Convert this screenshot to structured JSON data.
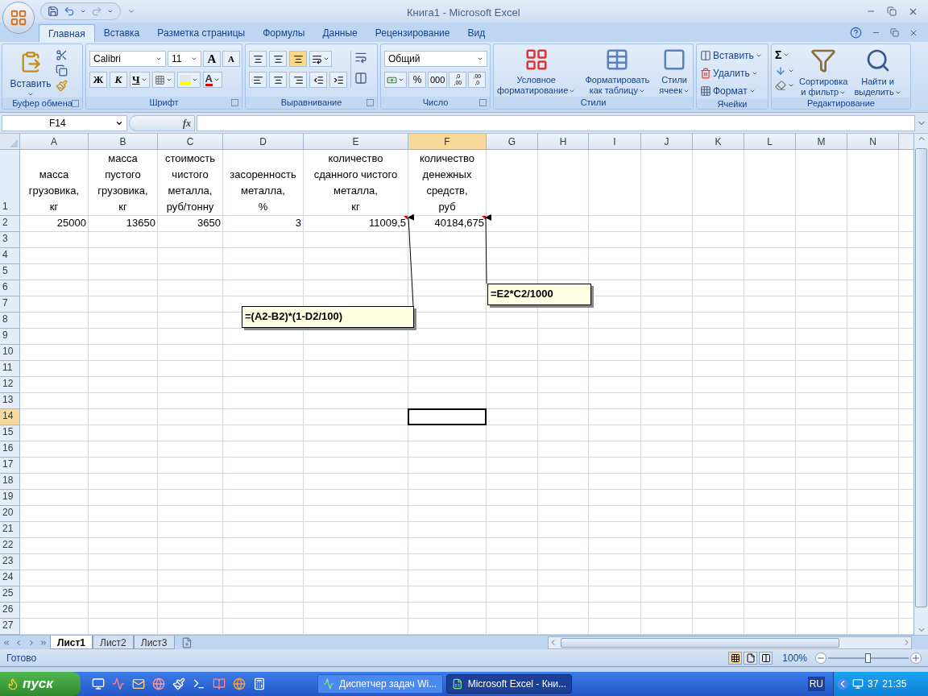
{
  "window": {
    "title": "Книга1 - Microsoft Excel"
  },
  "ribbon_tabs": [
    {
      "label": "Главная",
      "selected": true
    },
    {
      "label": "Вставка",
      "selected": false
    },
    {
      "label": "Разметка страницы",
      "selected": false
    },
    {
      "label": "Формулы",
      "selected": false
    },
    {
      "label": "Данные",
      "selected": false
    },
    {
      "label": "Рецензирование",
      "selected": false
    },
    {
      "label": "Вид",
      "selected": false
    }
  ],
  "clipboard": {
    "label": "Буфер обмена",
    "paste": "Вставить"
  },
  "font": {
    "label": "Шрифт",
    "name": "Calibri",
    "size": "11",
    "grow": "A",
    "shrink": "A",
    "bold": "Ж",
    "italic": "К",
    "underline": "Ч",
    "color_letter": "A"
  },
  "alignment": {
    "label": "Выравнивание",
    "vertical": [
      {
        "selected": false
      },
      {
        "selected": false
      },
      {
        "selected": true
      }
    ],
    "horizontal": [
      {
        "selected": false
      },
      {
        "selected": false
      },
      {
        "selected": false
      }
    ]
  },
  "number": {
    "label": "Число",
    "format": "Общий",
    "percent": "%",
    "thousands": "000",
    "increase_decimal": [
      ",0",
      ",00"
    ],
    "decrease_decimal": [
      ",00",
      ",0"
    ]
  },
  "styles": {
    "label": "Стили",
    "buttons": [
      {
        "kind": "conditional",
        "lines": [
          "Условное",
          "форматирование"
        ]
      },
      {
        "kind": "table",
        "lines": [
          "Форматировать",
          "как таблицу"
        ]
      },
      {
        "kind": "cell",
        "lines": [
          "Стили",
          "ячеек"
        ]
      }
    ]
  },
  "cells": {
    "label": "Ячейки",
    "buttons": [
      {
        "kind": "insert",
        "label": "Вставить"
      },
      {
        "kind": "delete",
        "label": "Удалить"
      },
      {
        "kind": "format",
        "label": "Формат"
      }
    ]
  },
  "editing": {
    "label": "Редактирование",
    "sum": "Σ",
    "buttons": [
      {
        "kind": "sort",
        "lines": [
          "Сортировка",
          "и фильтр"
        ]
      },
      {
        "kind": "find",
        "lines": [
          "Найти и",
          "выделить"
        ]
      }
    ]
  },
  "formula_bar": {
    "name_box": "F14",
    "fx": "fx"
  },
  "columns": [
    {
      "label": "A",
      "selected": false
    },
    {
      "label": "B",
      "selected": false
    },
    {
      "label": "C",
      "selected": false
    },
    {
      "label": "D",
      "selected": false
    },
    {
      "label": "E",
      "selected": false
    },
    {
      "label": "F",
      "selected": true
    },
    {
      "label": "G",
      "selected": false
    },
    {
      "label": "H",
      "selected": false
    },
    {
      "label": "I",
      "selected": false
    },
    {
      "label": "J",
      "selected": false
    },
    {
      "label": "K",
      "selected": false
    },
    {
      "label": "L",
      "selected": false
    },
    {
      "label": "M",
      "selected": false
    },
    {
      "label": "N",
      "selected": false
    }
  ],
  "rows": [
    {
      "label": "1",
      "selected": false,
      "kind": "header",
      "cells": [
        {
          "text": "масса\nгрузовика,\nкг",
          "comment": false
        },
        {
          "text": "масса\nпустого\nгрузовика,\nкг",
          "comment": false
        },
        {
          "text": "стоимость\nчистого\nметалла,\nруб/тонну",
          "comment": false
        },
        {
          "text": "засоренность\nметалла,\n%",
          "comment": false
        },
        {
          "text": "количество\nсданного чистого\nметалла,\nкг",
          "comment": false
        },
        {
          "text": "количество\nденежных\nсредств,\nруб",
          "comment": false
        }
      ]
    },
    {
      "label": "2",
      "selected": false,
      "kind": "values",
      "cells": [
        {
          "text": "25000",
          "comment": false
        },
        {
          "text": "13650",
          "comment": false
        },
        {
          "text": "3650",
          "comment": false
        },
        {
          "text": "3",
          "comment": false
        },
        {
          "text": "11009,5",
          "comment": true
        },
        {
          "text": "40184,675",
          "comment": true
        }
      ]
    },
    {
      "label": "3",
      "selected": false
    },
    {
      "label": "4",
      "selected": false
    },
    {
      "label": "5",
      "selected": false
    },
    {
      "label": "6",
      "selected": false
    },
    {
      "label": "7",
      "selected": false
    },
    {
      "label": "8",
      "selected": false
    },
    {
      "label": "9",
      "selected": false
    },
    {
      "label": "10",
      "selected": false
    },
    {
      "label": "11",
      "selected": false
    },
    {
      "label": "12",
      "selected": false
    },
    {
      "label": "13",
      "selected": false
    },
    {
      "label": "14",
      "selected": true
    },
    {
      "label": "15",
      "selected": false
    },
    {
      "label": "16",
      "selected": false
    },
    {
      "label": "17",
      "selected": false
    },
    {
      "label": "18",
      "selected": false
    },
    {
      "label": "19",
      "selected": false
    },
    {
      "label": "20",
      "selected": false
    },
    {
      "label": "21",
      "selected": false
    },
    {
      "label": "22",
      "selected": false
    },
    {
      "label": "23",
      "selected": false
    },
    {
      "label": "24",
      "selected": false
    },
    {
      "label": "25",
      "selected": false
    },
    {
      "label": "26",
      "selected": false
    },
    {
      "label": "27",
      "selected": false
    }
  ],
  "comments": [
    {
      "text": "=(A2-B2)*(1-D2/100)"
    },
    {
      "text": "=E2*C2/1000"
    }
  ],
  "sheet_tabs": [
    {
      "label": "Лист1",
      "selected": true
    },
    {
      "label": "Лист2",
      "selected": false
    },
    {
      "label": "Лист3",
      "selected": false
    }
  ],
  "status_bar": {
    "status": "Готово",
    "views": [
      {
        "kind": "normal",
        "selected": true
      },
      {
        "kind": "layout",
        "selected": false
      },
      {
        "kind": "pagebreak",
        "selected": false
      }
    ],
    "zoom": "100%",
    "zoom_slider": {
      "level": 0.5
    }
  },
  "taskbar": {
    "start": "пуск",
    "tasks": [
      {
        "label": "Диспетчер задач Wi...",
        "selected": false
      },
      {
        "label": "Microsoft Excel - Кни...",
        "selected": true
      }
    ],
    "language": "RU",
    "tray_number": "37",
    "clock": "21:35"
  }
}
